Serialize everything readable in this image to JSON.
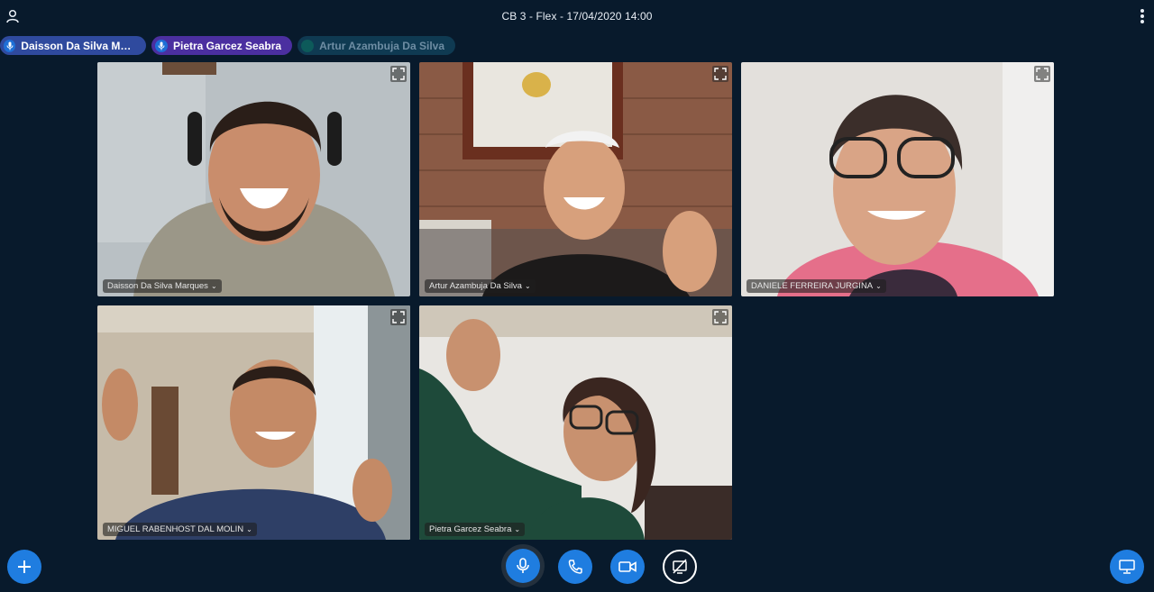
{
  "header": {
    "title": "CB 3 - Flex - 17/04/2020 14:00",
    "user_icon": "user-icon",
    "menu_icon": "kebab-menu-icon"
  },
  "talkers": [
    {
      "name": "Daisson Da Silva Mar…",
      "state": "talking"
    },
    {
      "name": "Pietra Garcez Seabra",
      "state": "talking"
    },
    {
      "name": "Artur Azambuja Da Silva",
      "state": "idle"
    }
  ],
  "videos": [
    {
      "name": "Daisson Da Silva Marques"
    },
    {
      "name": "Artur Azambuja Da Silva"
    },
    {
      "name": "DANIELE FERREIRA JURGINA"
    },
    {
      "name": "MIGUEL RABENHOST DAL MOLIN"
    },
    {
      "name": "Pietra Garcez Seabra"
    }
  ],
  "controls": {
    "actions_icon": "plus-icon",
    "mic_icon": "microphone-icon",
    "phone_icon": "phone-icon",
    "camera_icon": "video-camera-icon",
    "screenshare_icon": "screen-share-off-icon",
    "presentation_icon": "presentation-icon"
  },
  "colors": {
    "background": "#081a2c",
    "accent": "#1f7de0",
    "talker_1": "#2f4a9e",
    "talker_2": "#4b2fa0",
    "talker_idle": "#0f3a52"
  }
}
